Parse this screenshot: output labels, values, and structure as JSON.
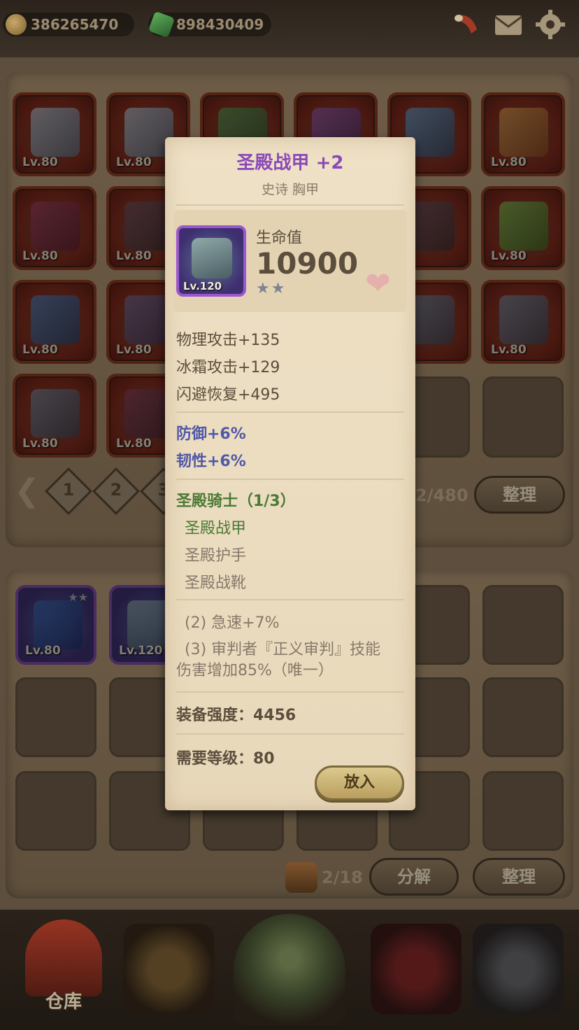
{
  "currency": {
    "gold": "386265470",
    "gems": "898430409"
  },
  "inventory": {
    "grid_levels": [
      "Lv.80",
      "Lv.80",
      "",
      "",
      "",
      "Lv.80",
      "Lv.80",
      "Lv.80",
      "",
      "",
      "",
      "Lv.80",
      "Lv.80",
      "Lv.80",
      "",
      "",
      "",
      "Lv.80",
      "Lv.80",
      "Lv.80"
    ],
    "pages": [
      "1",
      "2",
      "3"
    ],
    "capacity": "2/480",
    "sort_label": "整理"
  },
  "storage": {
    "item_levels": [
      "Lv.80",
      "Lv.120"
    ],
    "capacity": "2/18",
    "decompose_label": "分解",
    "sort_label": "整理"
  },
  "nav": {
    "warehouse_label": "仓库"
  },
  "tooltip": {
    "title": "圣殿战甲 +2",
    "subtitle": "史诗 胸甲",
    "item_level": "Lv.120",
    "main_stat_name": "生命值",
    "main_stat_value": "10900",
    "stars": "★★",
    "sub_stats": [
      "物理攻击+135",
      "冰霜攻击+129",
      "闪避恢复+495"
    ],
    "bonus_stats": [
      "防御+6%",
      "韧性+6%"
    ],
    "set_name": "圣殿骑士（1/3）",
    "set_pieces": [
      "圣殿战甲",
      "圣殿护手",
      "圣殿战靴"
    ],
    "set_bonus_1": "(2) 急速+7%",
    "set_bonus_2_line1": "(3) 审判者『正义审判』技能",
    "set_bonus_2_line2": "伤害增加85%（唯一）",
    "power": "装备强度：4456",
    "required_level": "需要等级：80",
    "place_label": "放入"
  }
}
